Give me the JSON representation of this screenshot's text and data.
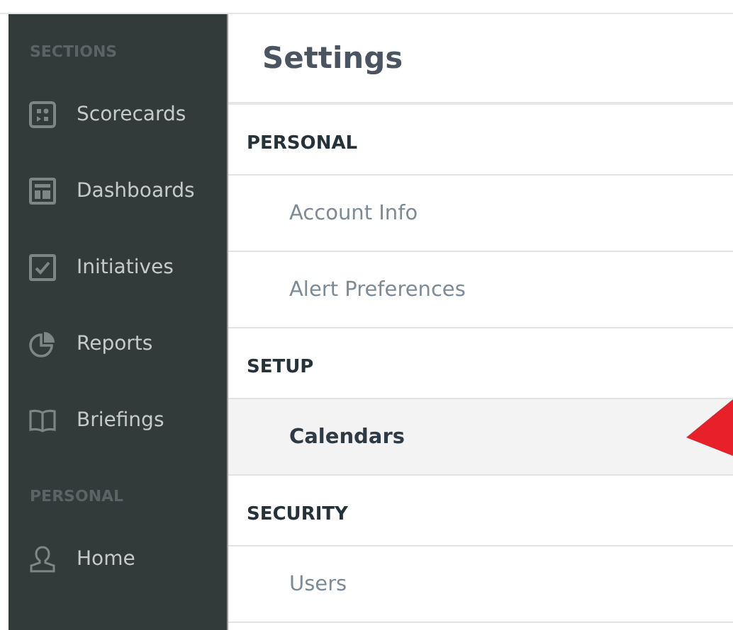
{
  "sidebar": {
    "groups": [
      {
        "heading": "SECTIONS",
        "items": [
          {
            "label": "Scorecards",
            "kind": "scorecards"
          },
          {
            "label": "Dashboards",
            "kind": "dashboards"
          },
          {
            "label": "Initiatives",
            "kind": "initiatives"
          },
          {
            "label": "Reports",
            "kind": "reports"
          },
          {
            "label": "Briefings",
            "kind": "briefings"
          }
        ]
      },
      {
        "heading": "PERSONAL",
        "items": [
          {
            "label": "Home",
            "kind": "home"
          }
        ]
      }
    ]
  },
  "main": {
    "title": "Settings",
    "sections": [
      {
        "heading": "PERSONAL",
        "items": [
          {
            "label": "Account Info",
            "selected": false
          },
          {
            "label": "Alert Preferences",
            "selected": false
          }
        ]
      },
      {
        "heading": "SETUP",
        "items": [
          {
            "label": "Calendars",
            "selected": true
          }
        ]
      },
      {
        "heading": "SECURITY",
        "items": [
          {
            "label": "Users",
            "selected": false
          }
        ]
      }
    ]
  }
}
